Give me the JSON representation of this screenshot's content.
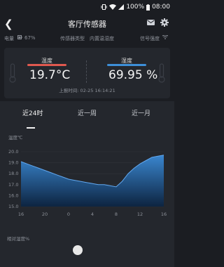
{
  "status": {
    "battery_pct": "100%",
    "time": "08:00"
  },
  "header": {
    "title": "客厅传感器"
  },
  "info": {
    "battery_label": "电量",
    "battery_value": "67%",
    "sensor_type_label": "传感器类型",
    "sensor_type_value": "内置温湿度",
    "signal_label": "信号强度"
  },
  "readings": {
    "temp_label": "温度",
    "temp_value": "19.7°C",
    "hum_label": "湿度",
    "hum_value": "69.95 %",
    "update_time": "上报时间: 02-25 16:14:21"
  },
  "tabs": [
    "近24时",
    "近一周",
    "近一月"
  ],
  "colors": {
    "temp": "#e0594f",
    "humidity": "#3d8fd8",
    "background": "#1b1d22",
    "card": "#24272d"
  },
  "chart_data": {
    "type": "area",
    "ylabel": "温度℃",
    "ylim": [
      15.0,
      20.0
    ],
    "yticks": [
      "15.0",
      "16.0",
      "17.0",
      "18.0",
      "19.0",
      "20.0"
    ],
    "xticks": [
      "16",
      "20",
      "0",
      "4",
      "8",
      "12",
      "16"
    ],
    "x": [
      16,
      17,
      18,
      19,
      20,
      21,
      22,
      23,
      24,
      25,
      26,
      27,
      28,
      29,
      30,
      31,
      32,
      33,
      34,
      35,
      36,
      37,
      38,
      39,
      40
    ],
    "values": [
      19.1,
      18.9,
      18.7,
      18.5,
      18.3,
      18.1,
      17.9,
      17.7,
      17.5,
      17.4,
      17.3,
      17.2,
      17.1,
      17.0,
      17.0,
      16.9,
      16.8,
      17.3,
      18.0,
      18.5,
      18.9,
      19.2,
      19.5,
      19.6,
      19.7
    ]
  },
  "bottom": {
    "humidity_label": "相对湿度%"
  }
}
